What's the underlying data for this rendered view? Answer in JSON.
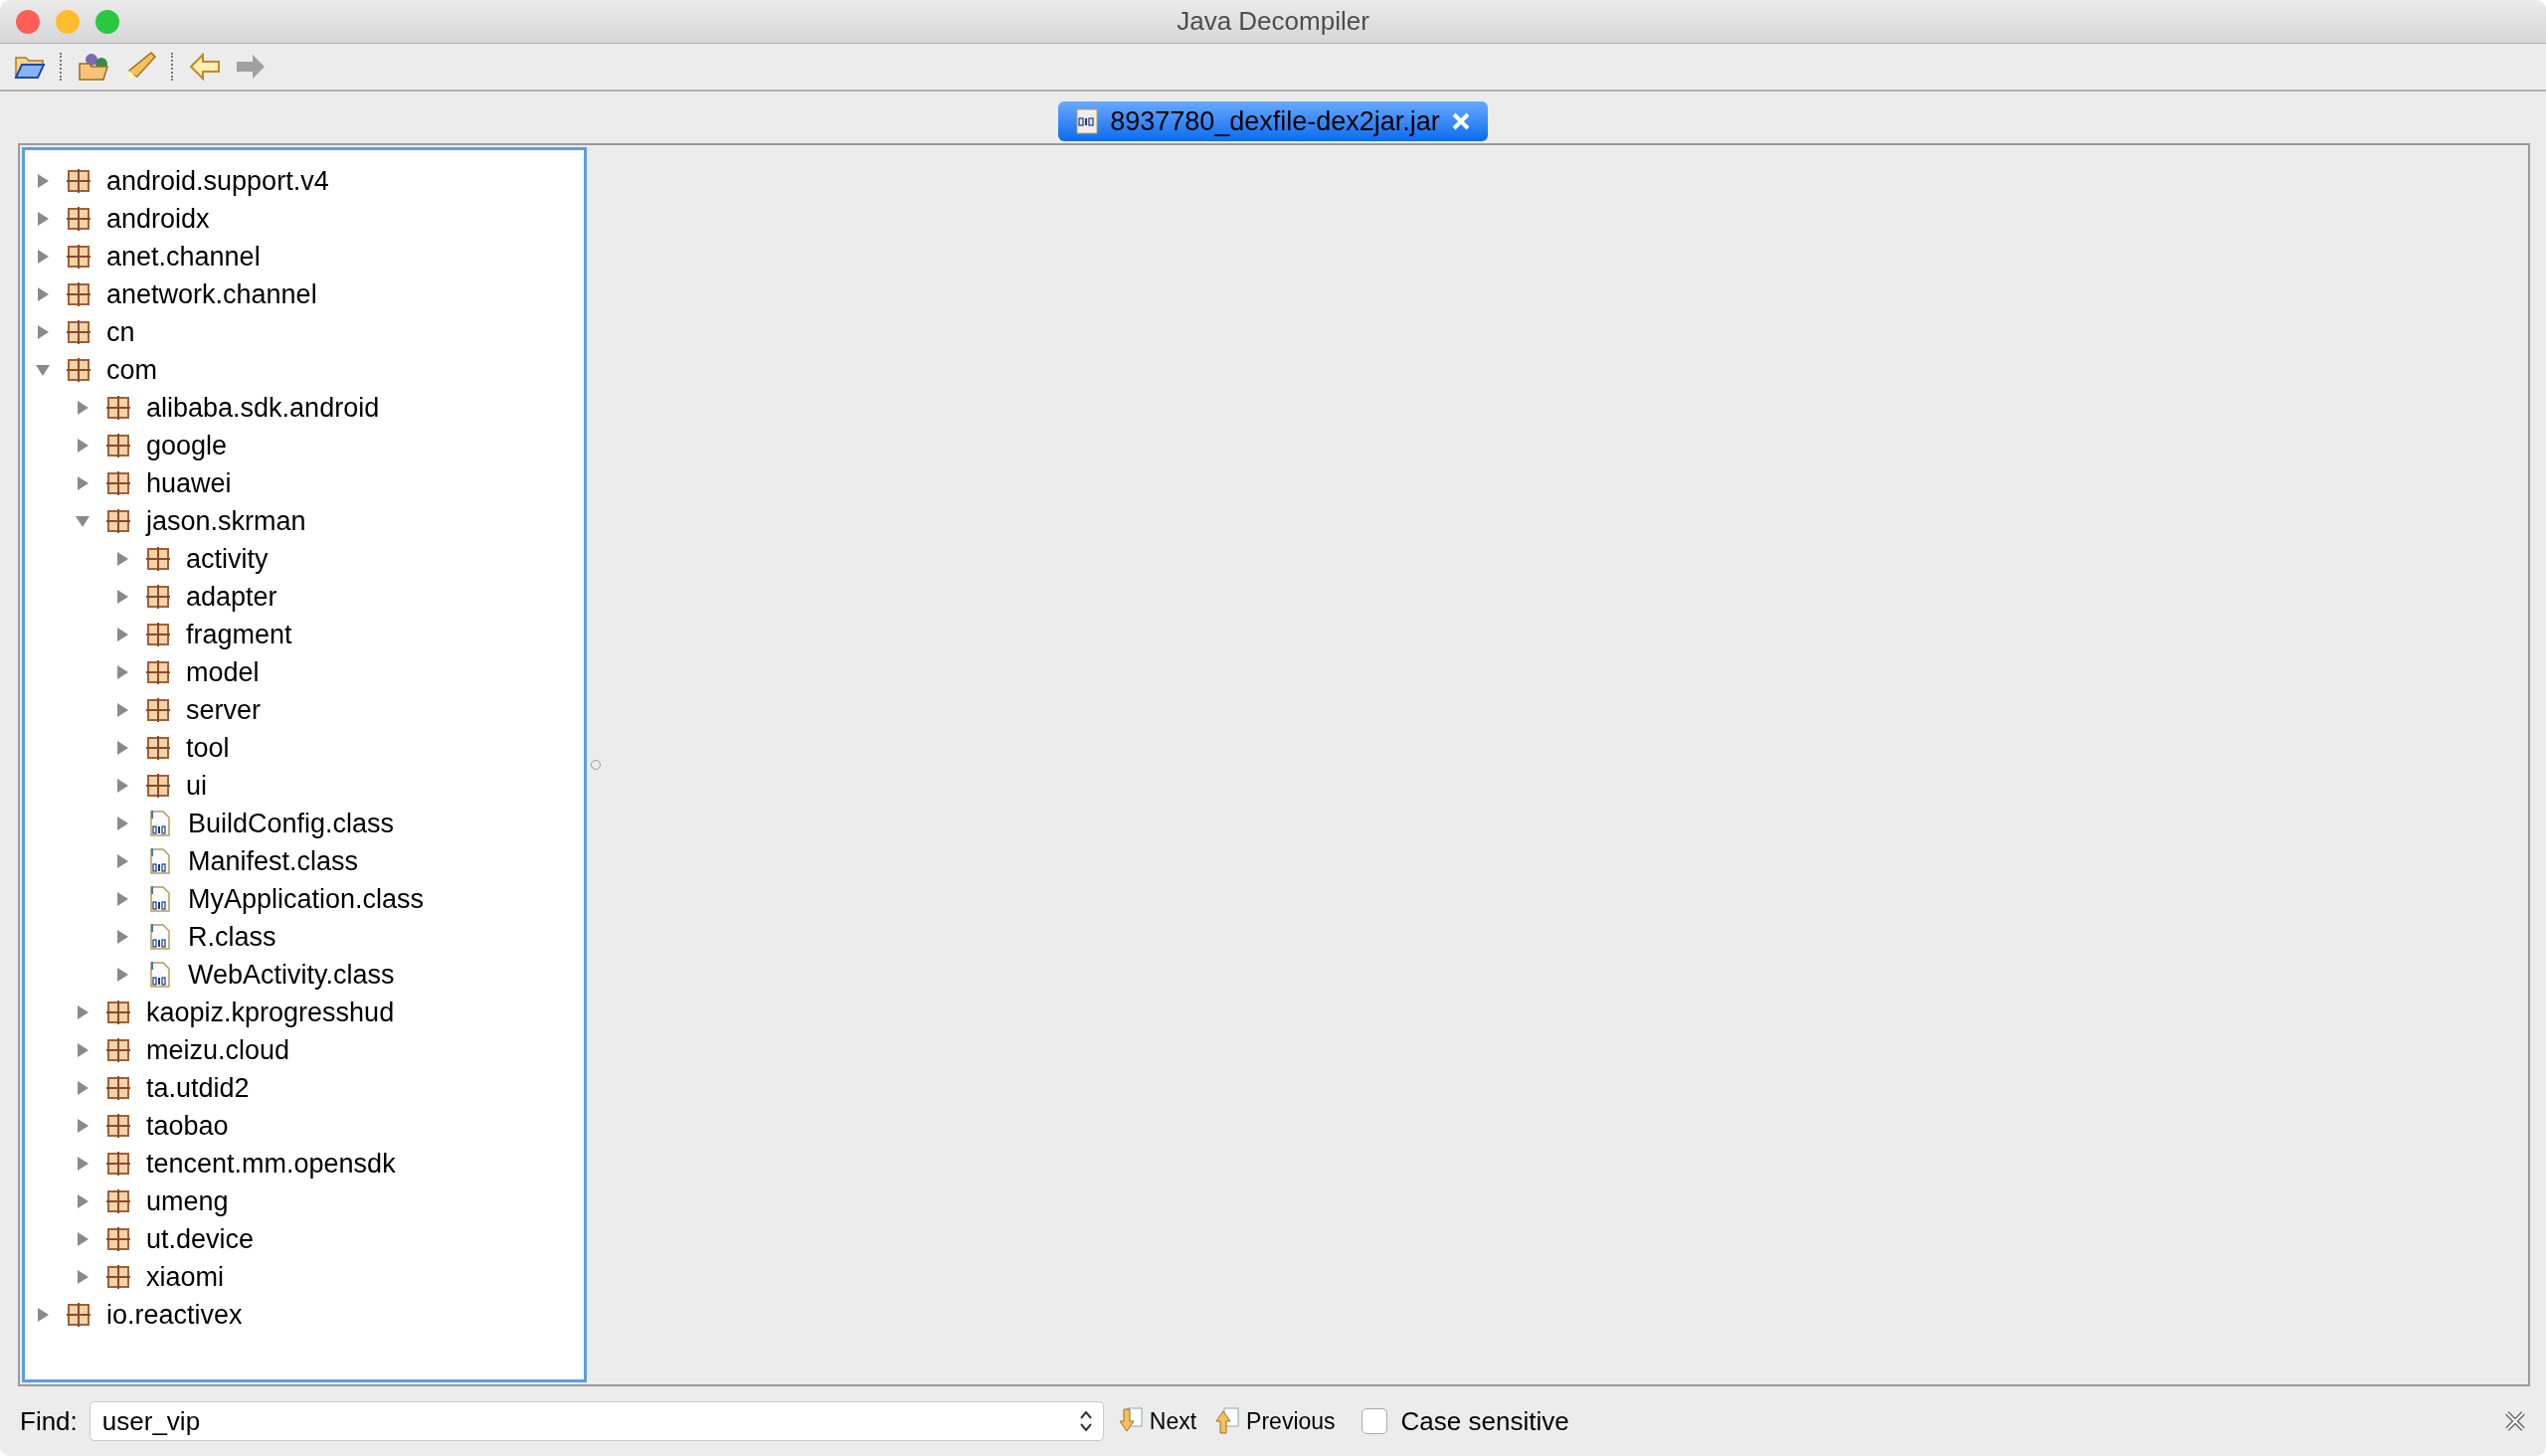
{
  "window": {
    "title": "Java Decompiler"
  },
  "tabs": [
    {
      "label": "8937780_dexfile-dex2jar.jar",
      "selected": true
    }
  ],
  "tree": [
    {
      "label": "android.support.v4",
      "kind": "package",
      "expanded": false
    },
    {
      "label": "androidx",
      "kind": "package",
      "expanded": false
    },
    {
      "label": "anet.channel",
      "kind": "package",
      "expanded": false
    },
    {
      "label": "anetwork.channel",
      "kind": "package",
      "expanded": false
    },
    {
      "label": "cn",
      "kind": "package",
      "expanded": false
    },
    {
      "label": "com",
      "kind": "package",
      "expanded": true,
      "children": [
        {
          "label": "alibaba.sdk.android",
          "kind": "package",
          "expanded": false
        },
        {
          "label": "google",
          "kind": "package",
          "expanded": false
        },
        {
          "label": "huawei",
          "kind": "package",
          "expanded": false
        },
        {
          "label": "jason.skrman",
          "kind": "package",
          "expanded": true,
          "children": [
            {
              "label": "activity",
              "kind": "package",
              "expanded": false
            },
            {
              "label": "adapter",
              "kind": "package",
              "expanded": false
            },
            {
              "label": "fragment",
              "kind": "package",
              "expanded": false
            },
            {
              "label": "model",
              "kind": "package",
              "expanded": false
            },
            {
              "label": "server",
              "kind": "package",
              "expanded": false
            },
            {
              "label": "tool",
              "kind": "package",
              "expanded": false
            },
            {
              "label": "ui",
              "kind": "package",
              "expanded": false
            },
            {
              "label": "BuildConfig.class",
              "kind": "class",
              "expanded": false
            },
            {
              "label": "Manifest.class",
              "kind": "class",
              "expanded": false
            },
            {
              "label": "MyApplication.class",
              "kind": "class",
              "expanded": false
            },
            {
              "label": "R.class",
              "kind": "class",
              "expanded": false
            },
            {
              "label": "WebActivity.class",
              "kind": "class",
              "expanded": false
            }
          ]
        },
        {
          "label": "kaopiz.kprogresshud",
          "kind": "package",
          "expanded": false
        },
        {
          "label": "meizu.cloud",
          "kind": "package",
          "expanded": false
        },
        {
          "label": "ta.utdid2",
          "kind": "package",
          "expanded": false
        },
        {
          "label": "taobao",
          "kind": "package",
          "expanded": false
        },
        {
          "label": "tencent.mm.opensdk",
          "kind": "package",
          "expanded": false
        },
        {
          "label": "umeng",
          "kind": "package",
          "expanded": false
        },
        {
          "label": "ut.device",
          "kind": "package",
          "expanded": false
        },
        {
          "label": "xiaomi",
          "kind": "package",
          "expanded": false
        }
      ]
    },
    {
      "label": "io.reactivex",
      "kind": "package",
      "expanded": false
    }
  ],
  "find": {
    "label": "Find:",
    "value": "user_vip",
    "next": "Next",
    "previous": "Previous",
    "case_sensitive": {
      "label": "Case sensitive",
      "checked": false
    }
  }
}
